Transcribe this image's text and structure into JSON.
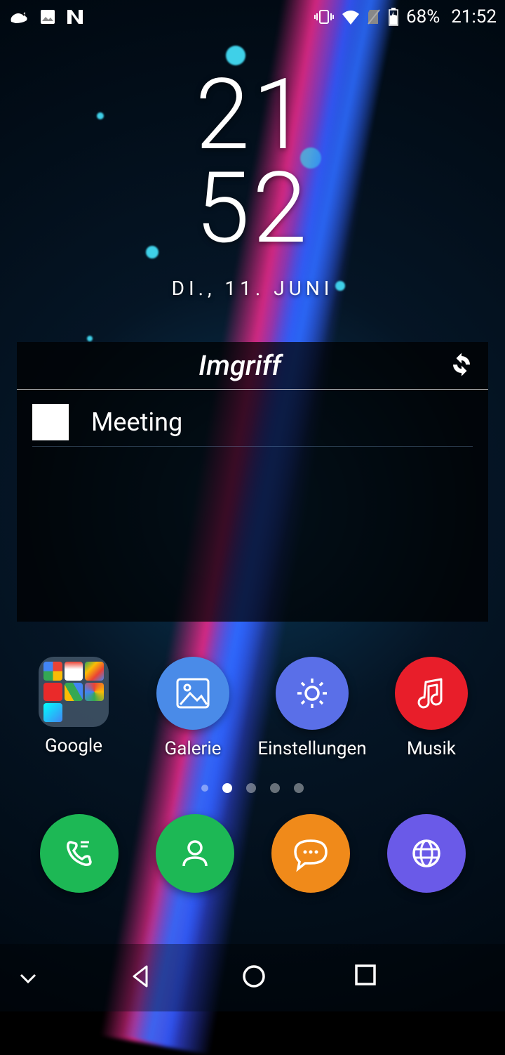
{
  "status": {
    "battery_text": "68%",
    "time": "21:52"
  },
  "clock": {
    "hours": "21",
    "minutes": "52",
    "date": "DI., 11. JUNI"
  },
  "agenda": {
    "title": "Imgriff",
    "items": [
      {
        "color": "#ffffff",
        "text": "Meeting"
      }
    ]
  },
  "apps": [
    {
      "label": "Google"
    },
    {
      "label": "Galerie"
    },
    {
      "label": "Einstellungen"
    },
    {
      "label": "Musik"
    }
  ],
  "page_count": 5,
  "active_page": 1,
  "colors": {
    "galerie": "#4a8be8",
    "einstellungen": "#5a6fe8",
    "musik": "#e81e2a",
    "phone": "#1db855",
    "contacts": "#1db855",
    "messages": "#f08a1a",
    "browser": "#6a5ae8"
  }
}
